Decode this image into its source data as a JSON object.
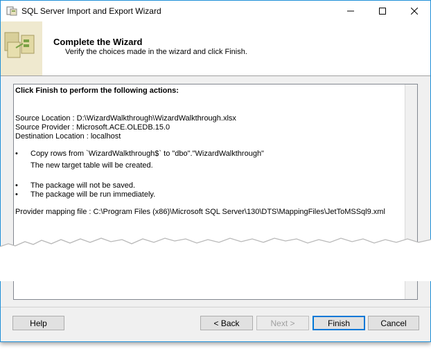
{
  "window": {
    "title": "SQL Server Import and Export Wizard"
  },
  "titlebar_buttons": {
    "minimize": "—",
    "maximize": "☐",
    "close": "✕"
  },
  "header": {
    "title": "Complete the Wizard",
    "subtitle": "Verify the choices made in the wizard and click Finish."
  },
  "summary": {
    "heading": "Click Finish to perform the following actions:",
    "source_location": "Source Location : D:\\WizardWalkthrough\\WizardWalkthrough.xlsx",
    "source_provider": "Source Provider : Microsoft.ACE.OLEDB.15.0",
    "destination_location": "Destination Location : localhost",
    "bullets": [
      "•",
      "•",
      "•"
    ],
    "copy_rows": "Copy rows from `WizardWalkthrough$` to \"dbo\".\"WizardWalkthrough\"",
    "new_table": "The new target table will be created.",
    "not_saved": "The package will not be saved.",
    "run_immediately": "The package will be run immediately.",
    "mapping_file": "Provider mapping file : C:\\Program Files (x86)\\Microsoft SQL Server\\130\\DTS\\MappingFiles\\JetToMSSql9.xml"
  },
  "buttons": {
    "help": "Help",
    "back": "< Back",
    "next": "Next >",
    "finish": "Finish",
    "cancel": "Cancel"
  },
  "icons": {
    "app": "wizard-app-icon",
    "header": "wizard-diagram-icon"
  }
}
